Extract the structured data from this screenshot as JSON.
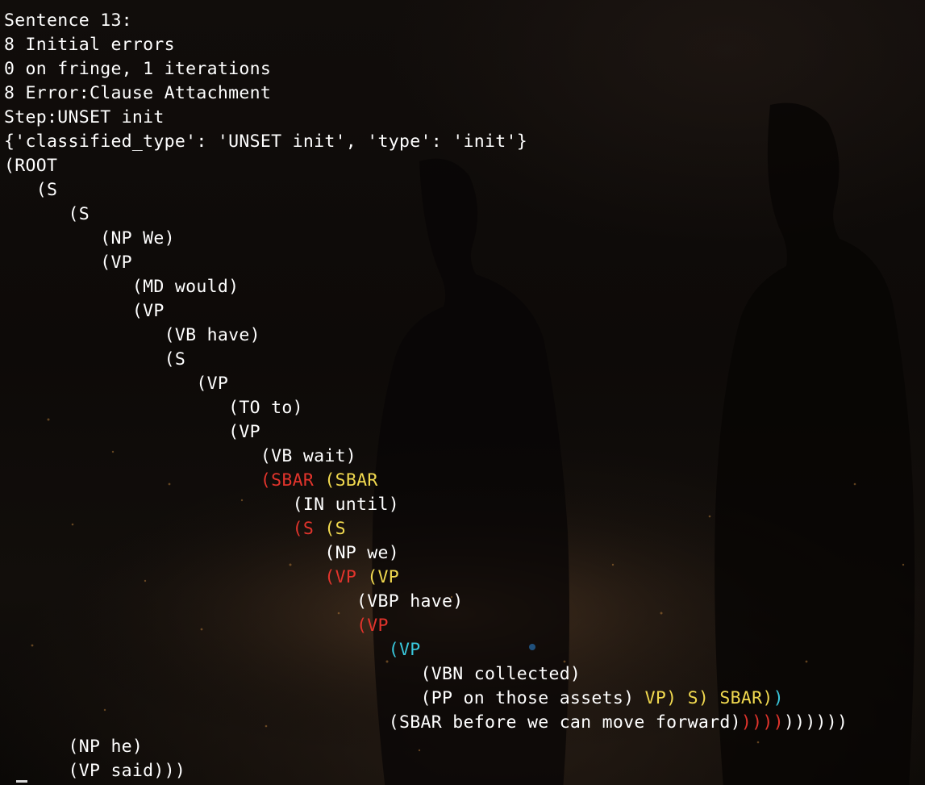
{
  "colors": {
    "default": "#ffffff",
    "red": "#e2342c",
    "yellow": "#f1d94f",
    "cyan": "#39c7dc"
  },
  "lines": [
    {
      "segments": [
        {
          "text": "Sentence 13:",
          "color": "default"
        }
      ]
    },
    {
      "segments": [
        {
          "text": "8 Initial errors",
          "color": "default"
        }
      ]
    },
    {
      "segments": [
        {
          "text": "0 on fringe, 1 iterations",
          "color": "default"
        }
      ]
    },
    {
      "segments": [
        {
          "text": "8 Error:Clause Attachment",
          "color": "default"
        }
      ]
    },
    {
      "segments": [
        {
          "text": "Step:UNSET init",
          "color": "default"
        }
      ]
    },
    {
      "segments": [
        {
          "text": "{'classified_type': 'UNSET init', 'type': 'init'}",
          "color": "default"
        }
      ]
    },
    {
      "segments": [
        {
          "text": "(ROOT",
          "color": "default"
        }
      ]
    },
    {
      "segments": [
        {
          "text": "   (S",
          "color": "default"
        }
      ]
    },
    {
      "segments": [
        {
          "text": "      (S",
          "color": "default"
        }
      ]
    },
    {
      "segments": [
        {
          "text": "         (NP We)",
          "color": "default"
        }
      ]
    },
    {
      "segments": [
        {
          "text": "         (VP",
          "color": "default"
        }
      ]
    },
    {
      "segments": [
        {
          "text": "            (MD would)",
          "color": "default"
        }
      ]
    },
    {
      "segments": [
        {
          "text": "            (VP",
          "color": "default"
        }
      ]
    },
    {
      "segments": [
        {
          "text": "               (VB have)",
          "color": "default"
        }
      ]
    },
    {
      "segments": [
        {
          "text": "               (S",
          "color": "default"
        }
      ]
    },
    {
      "segments": [
        {
          "text": "                  (VP",
          "color": "default"
        }
      ]
    },
    {
      "segments": [
        {
          "text": "                     (TO to)",
          "color": "default"
        }
      ]
    },
    {
      "segments": [
        {
          "text": "                     (VP",
          "color": "default"
        }
      ]
    },
    {
      "segments": [
        {
          "text": "                        (VB wait)",
          "color": "default"
        }
      ]
    },
    {
      "segments": [
        {
          "text": "                        ",
          "color": "default"
        },
        {
          "text": "(SBAR",
          "color": "red"
        },
        {
          "text": " ",
          "color": "default"
        },
        {
          "text": "(SBAR",
          "color": "yellow"
        }
      ]
    },
    {
      "segments": [
        {
          "text": "                           (IN until)",
          "color": "default"
        }
      ]
    },
    {
      "segments": [
        {
          "text": "                           ",
          "color": "default"
        },
        {
          "text": "(S",
          "color": "red"
        },
        {
          "text": " ",
          "color": "default"
        },
        {
          "text": "(S",
          "color": "yellow"
        }
      ]
    },
    {
      "segments": [
        {
          "text": "                              (NP we)",
          "color": "default"
        }
      ]
    },
    {
      "segments": [
        {
          "text": "                              ",
          "color": "default"
        },
        {
          "text": "(VP",
          "color": "red"
        },
        {
          "text": " ",
          "color": "default"
        },
        {
          "text": "(VP",
          "color": "yellow"
        }
      ]
    },
    {
      "segments": [
        {
          "text": "                                 (VBP have)",
          "color": "default"
        }
      ]
    },
    {
      "segments": [
        {
          "text": "                                 ",
          "color": "default"
        },
        {
          "text": "(VP",
          "color": "red"
        }
      ]
    },
    {
      "segments": [
        {
          "text": "                                    ",
          "color": "default"
        },
        {
          "text": "(VP",
          "color": "cyan"
        }
      ]
    },
    {
      "segments": [
        {
          "text": "                                       (VBN collected)",
          "color": "default"
        }
      ]
    },
    {
      "segments": [
        {
          "text": "                                       (PP on those assets) ",
          "color": "default"
        },
        {
          "text": "VP) S) SBAR)",
          "color": "yellow"
        },
        {
          "text": ")",
          "color": "cyan"
        }
      ]
    },
    {
      "segments": [
        {
          "text": "                                    (SBAR before we can move forward)",
          "color": "default"
        },
        {
          "text": "))))",
          "color": "red"
        },
        {
          "text": "))))))",
          "color": "default"
        }
      ]
    },
    {
      "segments": [
        {
          "text": "      (NP he)",
          "color": "default"
        }
      ]
    },
    {
      "segments": [
        {
          "text": "      (VP said)))",
          "color": "default"
        }
      ]
    }
  ]
}
